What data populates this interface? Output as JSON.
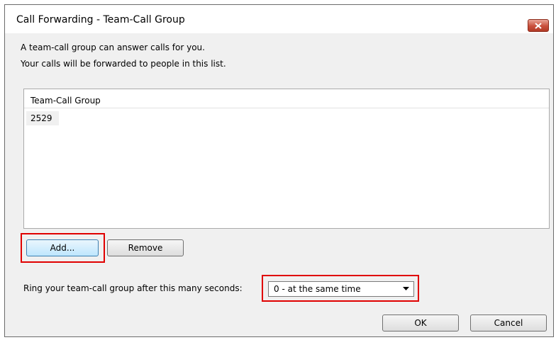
{
  "window": {
    "title": "Call Forwarding - Team-Call Group",
    "description_line1": "A team-call group can answer calls for you.",
    "description_line2": "Your calls will be forwarded to people in this list."
  },
  "list": {
    "header": "Team-Call Group",
    "items": [
      "2529"
    ]
  },
  "buttons": {
    "add": "Add...",
    "remove": "Remove",
    "ok": "OK",
    "cancel": "Cancel"
  },
  "ring": {
    "label": "Ring your team-call group after this many seconds:",
    "selected": "0 - at the same time"
  },
  "icons": {
    "close": "close-icon",
    "dropdown": "chevron-down-icon"
  },
  "colors": {
    "highlight": "#e00000",
    "close_button": "#c9503c"
  }
}
